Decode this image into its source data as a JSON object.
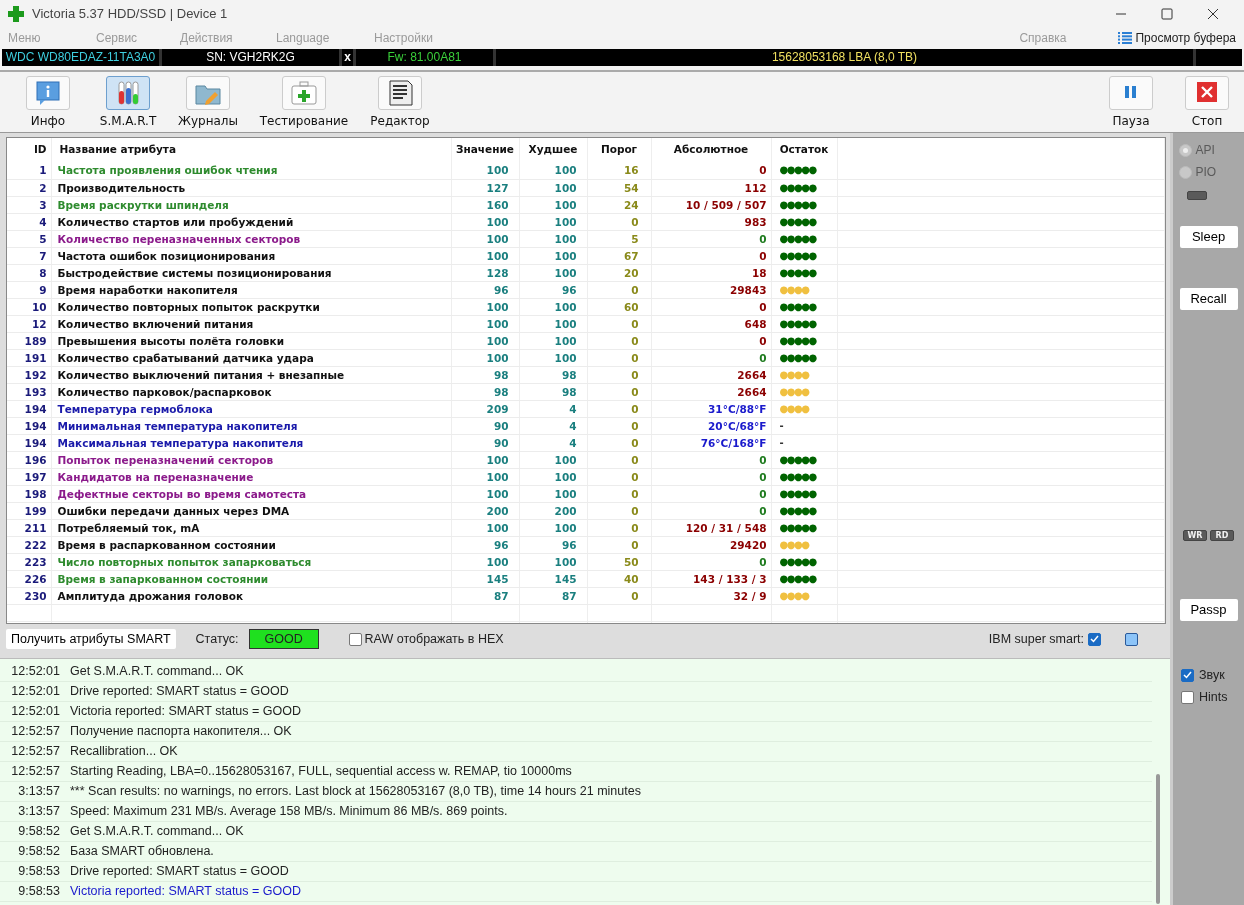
{
  "window": {
    "title": "Victoria 5.37 HDD/SSD | Device 1"
  },
  "menu": [
    {
      "label": "Меню",
      "disabled": true
    },
    {
      "label": "Сервис",
      "disabled": true
    },
    {
      "label": "Действия",
      "disabled": true
    },
    {
      "label": "Language",
      "disabled": true
    },
    {
      "label": "Настройки",
      "disabled": true
    },
    {
      "label": "Справка",
      "disabled": true
    }
  ],
  "buffer_view": {
    "label": "Просмотр буфера"
  },
  "drive_bar": {
    "model": "WDC WD80EDAZ-11TA3A0",
    "serial": "SN: VGH2RK2G",
    "close": "x",
    "firmware": "Fw: 81.00A81",
    "capacity": "15628053168 LBA (8,0 TB)"
  },
  "toolbar": [
    {
      "kind": "info",
      "label": "Инфо",
      "selected": false
    },
    {
      "kind": "smart",
      "label": "S.M.A.R.T",
      "selected": true
    },
    {
      "kind": "logs",
      "label": "Журналы",
      "selected": false
    },
    {
      "kind": "test",
      "label": "Тестирование",
      "selected": false
    },
    {
      "kind": "editor",
      "label": "Редактор",
      "selected": false
    }
  ],
  "toolbar_right": [
    {
      "kind": "pause",
      "label": "Пауза"
    },
    {
      "kind": "stop",
      "label": "Стоп"
    }
  ],
  "table": {
    "columns": [
      "ID",
      "Название атрибута",
      "Значение",
      "Худшее",
      "Порог",
      "Абсолютное",
      "Остаток"
    ],
    "rows": [
      {
        "id": "1",
        "name": {
          "text": "Частота проявления ошибок чтения",
          "color": "#2e8b2e"
        },
        "value": "100",
        "worst": "100",
        "threshold": "16",
        "raw": {
          "text": "0",
          "color": "#8b0000"
        },
        "rest": {
          "text": "●●●●●",
          "color": "#006400"
        }
      },
      {
        "id": "2",
        "name": {
          "text": "Производительность",
          "color": "#111111"
        },
        "value": "127",
        "worst": "100",
        "threshold": "54",
        "raw": {
          "text": "112",
          "color": "#8b0000"
        },
        "rest": {
          "text": "●●●●●",
          "color": "#006400"
        }
      },
      {
        "id": "3",
        "name": {
          "text": "Время раскрутки шпинделя",
          "color": "#2e8b2e"
        },
        "value": "160",
        "worst": "100",
        "threshold": "24",
        "raw": {
          "text": "10 / 509 / 507",
          "color": "#8b0000"
        },
        "rest": {
          "text": "●●●●●",
          "color": "#006400"
        }
      },
      {
        "id": "4",
        "name": {
          "text": "Количество стартов или пробуждений",
          "color": "#111111"
        },
        "value": "100",
        "worst": "100",
        "threshold": "0",
        "raw": {
          "text": "983",
          "color": "#8b0000"
        },
        "rest": {
          "text": "●●●●●",
          "color": "#006400"
        }
      },
      {
        "id": "5",
        "name": {
          "text": "Количество переназначенных секторов",
          "color": "#8b1a8b"
        },
        "value": "100",
        "worst": "100",
        "threshold": "5",
        "raw": {
          "text": "0",
          "color": "#1e7b1e"
        },
        "rest": {
          "text": "●●●●●",
          "color": "#006400"
        }
      },
      {
        "id": "7",
        "name": {
          "text": "Частота ошибок позиционирования",
          "color": "#111111"
        },
        "value": "100",
        "worst": "100",
        "threshold": "67",
        "raw": {
          "text": "0",
          "color": "#8b0000"
        },
        "rest": {
          "text": "●●●●●",
          "color": "#006400"
        }
      },
      {
        "id": "8",
        "name": {
          "text": "Быстродействие системы позиционирования",
          "color": "#111111"
        },
        "value": "128",
        "worst": "100",
        "threshold": "20",
        "raw": {
          "text": "18",
          "color": "#8b0000"
        },
        "rest": {
          "text": "●●●●●",
          "color": "#006400"
        }
      },
      {
        "id": "9",
        "name": {
          "text": "Время наработки накопителя",
          "color": "#111111"
        },
        "value": "96",
        "worst": "96",
        "threshold": "0",
        "raw": {
          "text": "29843",
          "color": "#8b0000"
        },
        "rest": {
          "text": "●●●●",
          "color": "#f0c040"
        }
      },
      {
        "id": "10",
        "name": {
          "text": "Количество повторных попыток раскрутки",
          "color": "#111111"
        },
        "value": "100",
        "worst": "100",
        "threshold": "60",
        "raw": {
          "text": "0",
          "color": "#8b0000"
        },
        "rest": {
          "text": "●●●●●",
          "color": "#006400"
        }
      },
      {
        "id": "12",
        "name": {
          "text": "Количество включений питания",
          "color": "#111111"
        },
        "value": "100",
        "worst": "100",
        "threshold": "0",
        "raw": {
          "text": "648",
          "color": "#8b0000"
        },
        "rest": {
          "text": "●●●●●",
          "color": "#006400"
        }
      },
      {
        "id": "189",
        "name": {
          "text": "Превышения высоты полёта головки",
          "color": "#111111"
        },
        "value": "100",
        "worst": "100",
        "threshold": "0",
        "raw": {
          "text": "0",
          "color": "#8b0000"
        },
        "rest": {
          "text": "●●●●●",
          "color": "#006400"
        }
      },
      {
        "id": "191",
        "name": {
          "text": "Количество срабатываний датчика удара",
          "color": "#111111"
        },
        "value": "100",
        "worst": "100",
        "threshold": "0",
        "raw": {
          "text": "0",
          "color": "#1e7b1e"
        },
        "rest": {
          "text": "●●●●●",
          "color": "#006400"
        }
      },
      {
        "id": "192",
        "name": {
          "text": "Количество выключений питания + внезапные",
          "color": "#111111"
        },
        "value": "98",
        "worst": "98",
        "threshold": "0",
        "raw": {
          "text": "2664",
          "color": "#8b0000"
        },
        "rest": {
          "text": "●●●●",
          "color": "#f0c040"
        }
      },
      {
        "id": "193",
        "name": {
          "text": "Количество парковок/распарковок",
          "color": "#111111"
        },
        "value": "98",
        "worst": "98",
        "threshold": "0",
        "raw": {
          "text": "2664",
          "color": "#8b0000"
        },
        "rest": {
          "text": "●●●●",
          "color": "#f0c040"
        }
      },
      {
        "id": "194",
        "name": {
          "text": "Температура гермоблока",
          "color": "#1a1aaa"
        },
        "value": "209",
        "worst": "4",
        "threshold": "0",
        "raw": {
          "text": "31°C/88°F",
          "color": "#1a1acc"
        },
        "rest": {
          "text": "●●●●",
          "color": "#f0c040"
        }
      },
      {
        "id": "194",
        "name": {
          "text": "Минимальная температура накопителя",
          "color": "#1a1aaa"
        },
        "value": "90",
        "worst": "4",
        "threshold": "0",
        "raw": {
          "text": "20°C/68°F",
          "color": "#1a1acc"
        },
        "rest": {
          "text": "-",
          "color": "#333333"
        }
      },
      {
        "id": "194",
        "name": {
          "text": "Максимальная температура накопителя",
          "color": "#1a1aaa"
        },
        "value": "90",
        "worst": "4",
        "threshold": "0",
        "raw": {
          "text": "76°C/168°F",
          "color": "#1a1acc"
        },
        "rest": {
          "text": "-",
          "color": "#333333"
        }
      },
      {
        "id": "196",
        "name": {
          "text": "Попыток переназначений секторов",
          "color": "#8b1a8b"
        },
        "value": "100",
        "worst": "100",
        "threshold": "0",
        "raw": {
          "text": "0",
          "color": "#1e7b1e"
        },
        "rest": {
          "text": "●●●●●",
          "color": "#006400"
        }
      },
      {
        "id": "197",
        "name": {
          "text": "Кандидатов на переназначение",
          "color": "#8b1a8b"
        },
        "value": "100",
        "worst": "100",
        "threshold": "0",
        "raw": {
          "text": "0",
          "color": "#1e7b1e"
        },
        "rest": {
          "text": "●●●●●",
          "color": "#006400"
        }
      },
      {
        "id": "198",
        "name": {
          "text": "Дефектные секторы во время самотеста",
          "color": "#8b1a8b"
        },
        "value": "100",
        "worst": "100",
        "threshold": "0",
        "raw": {
          "text": "0",
          "color": "#1e7b1e"
        },
        "rest": {
          "text": "●●●●●",
          "color": "#006400"
        }
      },
      {
        "id": "199",
        "name": {
          "text": "Ошибки передачи данных через DMA",
          "color": "#111111"
        },
        "value": "200",
        "worst": "200",
        "threshold": "0",
        "raw": {
          "text": "0",
          "color": "#1e7b1e"
        },
        "rest": {
          "text": "●●●●●",
          "color": "#006400"
        }
      },
      {
        "id": "211",
        "name": {
          "text": "Потребляемый ток, mA",
          "color": "#111111"
        },
        "value": "100",
        "worst": "100",
        "threshold": "0",
        "raw": {
          "text": "120 / 31 / 548",
          "color": "#8b0000"
        },
        "rest": {
          "text": "●●●●●",
          "color": "#006400"
        }
      },
      {
        "id": "222",
        "name": {
          "text": "Время в распаркованном состоянии",
          "color": "#111111"
        },
        "value": "96",
        "worst": "96",
        "threshold": "0",
        "raw": {
          "text": "29420",
          "color": "#8b0000"
        },
        "rest": {
          "text": "●●●●",
          "color": "#f0c040"
        }
      },
      {
        "id": "223",
        "name": {
          "text": "Число повторных попыток запарковаться",
          "color": "#2e8b2e"
        },
        "value": "100",
        "worst": "100",
        "threshold": "50",
        "raw": {
          "text": "0",
          "color": "#1e7b1e"
        },
        "rest": {
          "text": "●●●●●",
          "color": "#006400"
        }
      },
      {
        "id": "226",
        "name": {
          "text": "Время в запаркованном состоянии",
          "color": "#2e8b2e"
        },
        "value": "145",
        "worst": "145",
        "threshold": "40",
        "raw": {
          "text": "143 / 133 / 3",
          "color": "#8b0000"
        },
        "rest": {
          "text": "●●●●●",
          "color": "#006400"
        }
      },
      {
        "id": "230",
        "name": {
          "text": "Амплитуда дрожания головок",
          "color": "#111111"
        },
        "value": "87",
        "worst": "87",
        "threshold": "0",
        "raw": {
          "text": "32 / 9",
          "color": "#8b0000"
        },
        "rest": {
          "text": "●●●●",
          "color": "#f0c040"
        }
      }
    ]
  },
  "smart_bar": {
    "button": "Получить атрибуты SMART",
    "status_label": "Статус:",
    "status": "GOOD",
    "raw_hex": {
      "label": "RAW отображать в HEX",
      "checked": false
    },
    "ibm": {
      "label": "IBM super smart:",
      "checked": true
    }
  },
  "side_panel": {
    "modes": [
      {
        "label": "API",
        "selected": true,
        "disabled": true
      },
      {
        "label": "PIO",
        "selected": false,
        "disabled": true
      }
    ],
    "buttons": [
      {
        "kind": "button",
        "label": "Sleep"
      },
      {
        "kind": "button",
        "label": "Recall"
      },
      {
        "kind": "indicators",
        "labels": [
          "WR",
          "RD"
        ]
      },
      {
        "kind": "button",
        "label": "Passp"
      }
    ]
  },
  "log": [
    {
      "time": "12:52:01",
      "text": "Get S.M.A.R.T. command... OK",
      "color": "#222222"
    },
    {
      "time": "12:52:01",
      "text": "Drive reported: SMART status = GOOD",
      "color": "#222222"
    },
    {
      "time": "12:52:01",
      "text": "Victoria reported: SMART status = GOOD",
      "color": "#222222"
    },
    {
      "time": "12:52:57",
      "text": "Получение паспорта накопителя... OK",
      "color": "#222222"
    },
    {
      "time": "12:52:57",
      "text": "Recallibration... OK",
      "color": "#222222"
    },
    {
      "time": "12:52:57",
      "text": "Starting Reading, LBA=0..15628053167, FULL, sequential access w. REMAP, tio 10000ms",
      "color": "#222222"
    },
    {
      "time": "3:13:57",
      "text": "*** Scan results: no warnings, no errors. Last block at 15628053167 (8,0 TB), time 14 hours 21 minutes",
      "color": "#222222"
    },
    {
      "time": "3:13:57",
      "text": "Speed: Maximum 231 MB/s. Average 158 MB/s. Minimum 86 MB/s. 869 points.",
      "color": "#222222"
    },
    {
      "time": "9:58:52",
      "text": "Get S.M.A.R.T. command... OK",
      "color": "#222222"
    },
    {
      "time": "9:58:52",
      "text": "База SMART обновлена.",
      "color": "#222222"
    },
    {
      "time": "9:58:53",
      "text": "Drive reported: SMART status = GOOD",
      "color": "#222222"
    },
    {
      "time": "9:58:53",
      "text": "Victoria reported: SMART status = GOOD",
      "color": "#1a1acc"
    }
  ],
  "log_options": [
    {
      "label": "Звук",
      "checked": true
    },
    {
      "label": "Hints",
      "checked": false
    }
  ]
}
